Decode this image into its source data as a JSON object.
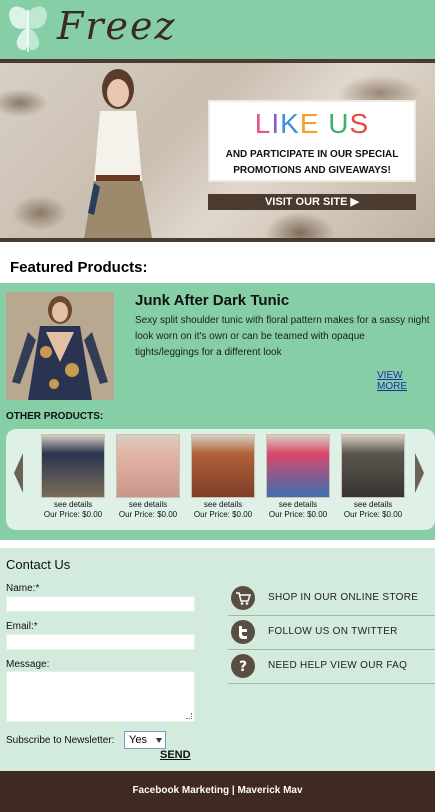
{
  "header": {
    "logo_text": "Freez"
  },
  "banner": {
    "like_title_letters": [
      {
        "ch": "L",
        "color": "#e6508c"
      },
      {
        "ch": "I",
        "color": "#8b59c9"
      },
      {
        "ch": "K",
        "color": "#3d8fd8"
      },
      {
        "ch": "E",
        "color": "#f2a02a"
      },
      {
        "ch": " ",
        "color": "#000000"
      },
      {
        "ch": "U",
        "color": "#3fb26a"
      },
      {
        "ch": "S",
        "color": "#e84b3c"
      }
    ],
    "like_subtitle_line1": "AND PARTICIPATE IN OUR SPECIAL",
    "like_subtitle_line2": "PROMOTIONS AND GIVEAWAYS!",
    "visit_button": "VISIT OUR SITE"
  },
  "featured": {
    "heading": "Featured Products:",
    "title": "Junk After Dark Tunic",
    "description": "Sexy split shoulder tunic with floral pattern makes for a sassy night look worn on it's own or can be teamed with opaque tights/leggings for a different look",
    "view_more": "VIEW MORE"
  },
  "other_products": {
    "label": "OTHER PRODUCTS:",
    "items": [
      {
        "details": "see details",
        "price": "Our Price: $0.00",
        "colors": [
          "#2b3550",
          "#7a6c5a"
        ]
      },
      {
        "details": "see details",
        "price": "Our Price: $0.00",
        "colors": [
          "#e3b4a6",
          "#c9978a"
        ]
      },
      {
        "details": "see details",
        "price": "Our Price: $0.00",
        "colors": [
          "#b0623a",
          "#7f3d28"
        ]
      },
      {
        "details": "see details",
        "price": "Our Price: $0.00",
        "colors": [
          "#d9486a",
          "#3b6fb0"
        ]
      },
      {
        "details": "see details",
        "price": "Our Price: $0.00",
        "colors": [
          "#5a5650",
          "#38342f"
        ]
      }
    ]
  },
  "contact": {
    "title": "Contact Us",
    "name_label": "Name:*",
    "email_label": "Email:*",
    "message_label": "Message:",
    "newsletter_label": "Subscribe to Newsletter:",
    "newsletter_value": "Yes",
    "send_button": "SEND",
    "links": [
      {
        "label": "SHOP IN OUR ONLINE STORE",
        "icon": "cart-icon"
      },
      {
        "label": "FOLLOW US ON TWITTER",
        "icon": "twitter-icon"
      },
      {
        "label": "NEED HELP VIEW OUR FAQ",
        "icon": "question-icon"
      }
    ]
  },
  "footer": {
    "left": "Facebook Marketing",
    "separator": "|",
    "right": "Maverick Mav"
  },
  "colors": {
    "brand_green": "#86cfa6",
    "brand_brown": "#3e2a20",
    "light_green": "#d3ebdc"
  }
}
